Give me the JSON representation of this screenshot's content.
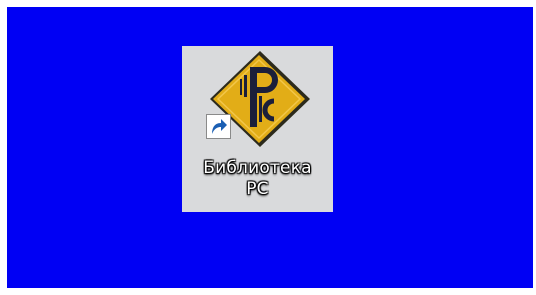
{
  "desktop": {
    "background_color": "#0000f4",
    "icons": [
      {
        "label_line1": "Библиотека",
        "label_line2": "РС",
        "icon": "library-rs-logo-icon",
        "overlay": "shortcut-arrow-icon",
        "selected": true,
        "logo_text": "РС"
      }
    ]
  }
}
